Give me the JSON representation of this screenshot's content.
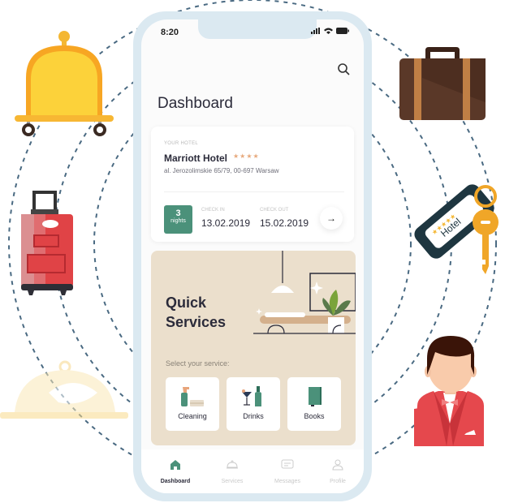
{
  "status_bar": {
    "time": "8:20"
  },
  "header": {
    "title": "Dashboard",
    "search_icon": "search-icon"
  },
  "hotel": {
    "section_label": "YOUR HOTEL",
    "name": "Marriott Hotel",
    "stars": "★★★★",
    "star_count": 4,
    "address": "al. Jerozolimskie 65/79, 00-697 Warsaw",
    "nights_count": "3",
    "nights_label": "nights",
    "check_in_label": "CHECK IN",
    "check_in": "13.02.2019",
    "check_out_label": "CHECK OUT",
    "check_out": "15.02.2019",
    "arrow": "→"
  },
  "quick_services": {
    "title": "Quick Services",
    "subtitle": "Select your service:",
    "services": [
      {
        "label": "Cleaning",
        "icon": "cleaning-icon"
      },
      {
        "label": "Drinks",
        "icon": "drinks-icon"
      },
      {
        "label": "Books",
        "icon": "book-icon"
      }
    ]
  },
  "bottom_nav": [
    {
      "label": "Dashboard",
      "icon": "home-icon",
      "active": true
    },
    {
      "label": "Services",
      "icon": "cloche-icon",
      "active": false
    },
    {
      "label": "Messages",
      "icon": "message-icon",
      "active": false
    },
    {
      "label": "Profile",
      "icon": "profile-icon",
      "active": false
    }
  ],
  "decorations": {
    "key_tag_text": "Hotel",
    "key_tag_stars": "★★★★★"
  },
  "colors": {
    "accent": "#4b917a",
    "card_beige": "#ebdfcc",
    "phone_frame": "#dbe9f1",
    "star": "#e7a97c",
    "orbit": "#4a6a82"
  }
}
